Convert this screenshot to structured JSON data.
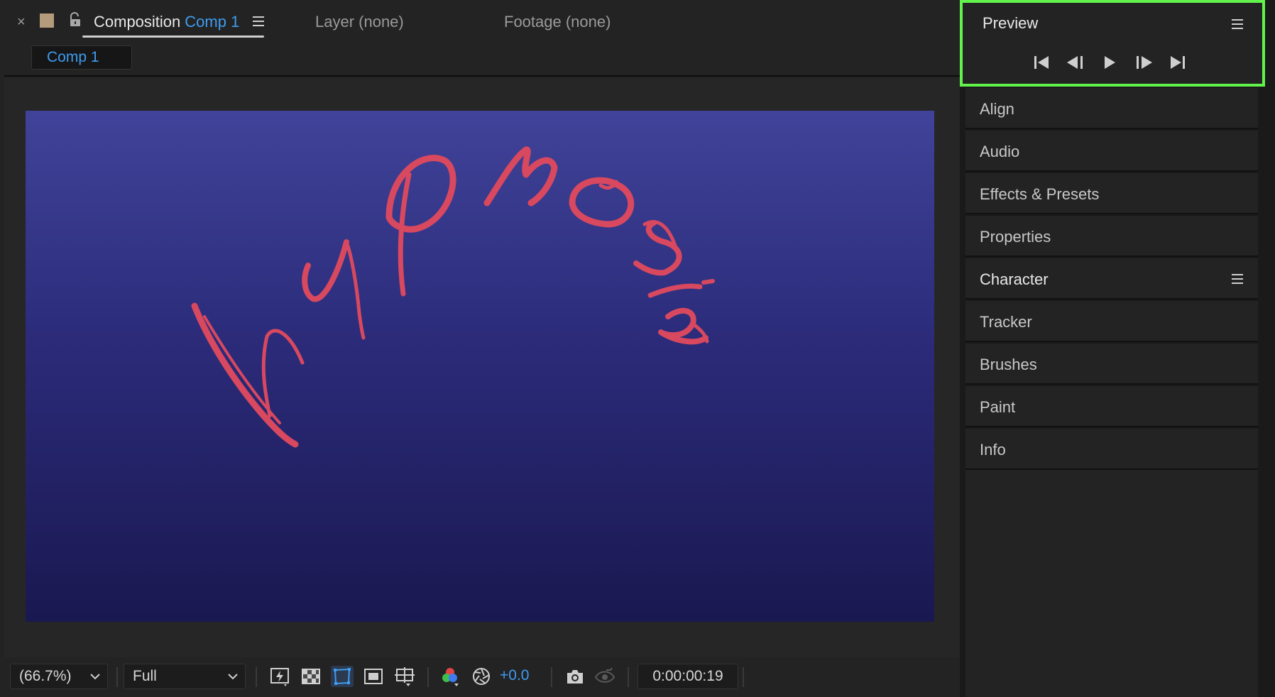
{
  "comp_tabs": {
    "close_glyph": "×",
    "composition_label": "Composition",
    "composition_name": "Comp 1",
    "layer_tab": "Layer (none)",
    "footage_tab": "Footage (none)",
    "swatch_color": "#b39b7b"
  },
  "comp_subtab": {
    "label": "Comp 1"
  },
  "canvas": {
    "text": "hypnosis",
    "text_color": "#d8485f",
    "bg_top": "#404399",
    "bg_bottom": "#1a1850"
  },
  "toolbar": {
    "zoom": "(66.7%)",
    "resolution": "Full",
    "exposure": "+0.0",
    "timecode": "0:00:00:19"
  },
  "preview_panel": {
    "title": "Preview",
    "highlight_color": "#62f24c",
    "controls": [
      "first-frame-icon",
      "prev-frame-icon",
      "play-icon",
      "next-frame-icon",
      "last-frame-icon"
    ]
  },
  "panels": [
    {
      "label": "Align"
    },
    {
      "label": "Audio"
    },
    {
      "label": "Effects & Presets"
    },
    {
      "label": "Properties"
    },
    {
      "label": "Character"
    },
    {
      "label": "Tracker"
    },
    {
      "label": "Brushes"
    },
    {
      "label": "Paint"
    },
    {
      "label": "Info"
    }
  ]
}
